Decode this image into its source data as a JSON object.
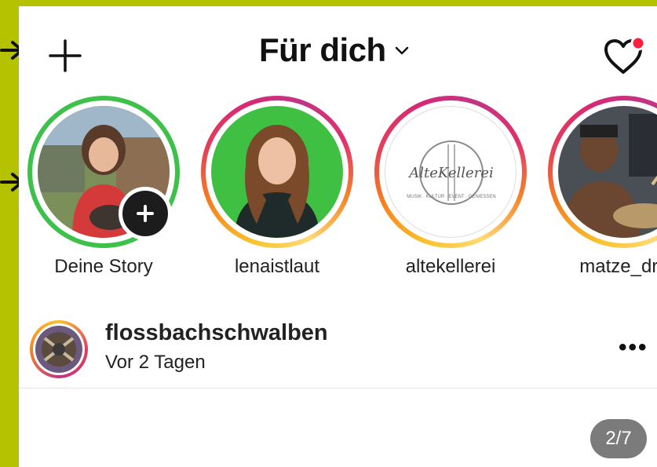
{
  "header": {
    "title": "Für dich",
    "title_chevron": "chevron-down-icon",
    "left_icon": "plus-icon",
    "right_icon": "heart-icon",
    "notification_dot_color": "#ff1f3d"
  },
  "colors": {
    "frame": "#b5c200",
    "story_ring_own": "#3ec14a",
    "counter_bg": "#7b7b7b"
  },
  "stories": [
    {
      "label": "Deine Story",
      "ring": "green",
      "has_add_badge": true
    },
    {
      "label": "lenaistlaut",
      "ring": "gradient"
    },
    {
      "label": "altekellerei",
      "ring": "gradient",
      "logo_text": "AlteKellerei",
      "logo_subtext": "MUSIK · KULTUR · EVENT · GENIESSEN"
    },
    {
      "label": "matze_dru",
      "ring": "gradient"
    }
  ],
  "post": {
    "username": "flossbachschwalben",
    "time": "Vor 2 Tagen",
    "more_label": "•••",
    "counter": "2/7"
  }
}
